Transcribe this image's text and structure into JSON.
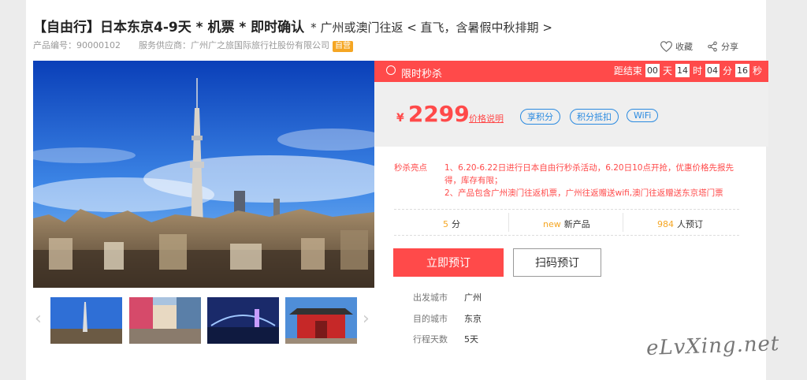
{
  "product": {
    "title": "【自由行】日本东京4-9天 * 机票 * 即时确认",
    "subtitle": "* 广州或澳门往返 < 直飞，含暑假中秋排期 >",
    "code_label": "产品编号：90000102",
    "supplier_label": "服务供应商：广州广之旅国际旅行社股份有限公司",
    "badge": "自营"
  },
  "actions": {
    "favorite": "收藏",
    "share": "分享"
  },
  "gallery": {
    "prev_icon": "‹",
    "next_icon": "›"
  },
  "flash_sale": {
    "label": "限时秒杀",
    "countdown_label": "距结束",
    "days": "00",
    "days_unit": "天",
    "hours": "14",
    "hours_unit": "时",
    "minutes": "04",
    "minutes_unit": "分",
    "seconds": "16",
    "seconds_unit": "秒"
  },
  "price": {
    "currency": "¥",
    "value": "2299",
    "explain": "价格说明",
    "tags": [
      "享积分",
      "积分抵扣",
      "WiFi"
    ]
  },
  "seckill": {
    "label": "秒杀亮点",
    "line1": "1、6.20-6.22日进行日本自由行秒杀活动，6.20日10点开抢，优惠价格先报先得，库存有限；",
    "line2": "2、产品包含广州澳门往返机票，广州往返赠送wifi,澳门往返赠送东京塔门票"
  },
  "stats": {
    "score_value": "5",
    "score_unit": "分",
    "new_value": "new",
    "new_label": "新产品",
    "booked_value": "984",
    "booked_label": "人预订"
  },
  "buttons": {
    "book": "立即预订",
    "scan": "扫码预订"
  },
  "info": [
    {
      "label": "出发城市",
      "value": "广州"
    },
    {
      "label": "目的城市",
      "value": "东京"
    },
    {
      "label": "行程天数",
      "value": "5天"
    }
  ],
  "watermark": "eLvXing.net",
  "colors": {
    "accent": "#ff4a4a",
    "tag_blue": "#2a8ae0",
    "orange": "#f5a623"
  }
}
